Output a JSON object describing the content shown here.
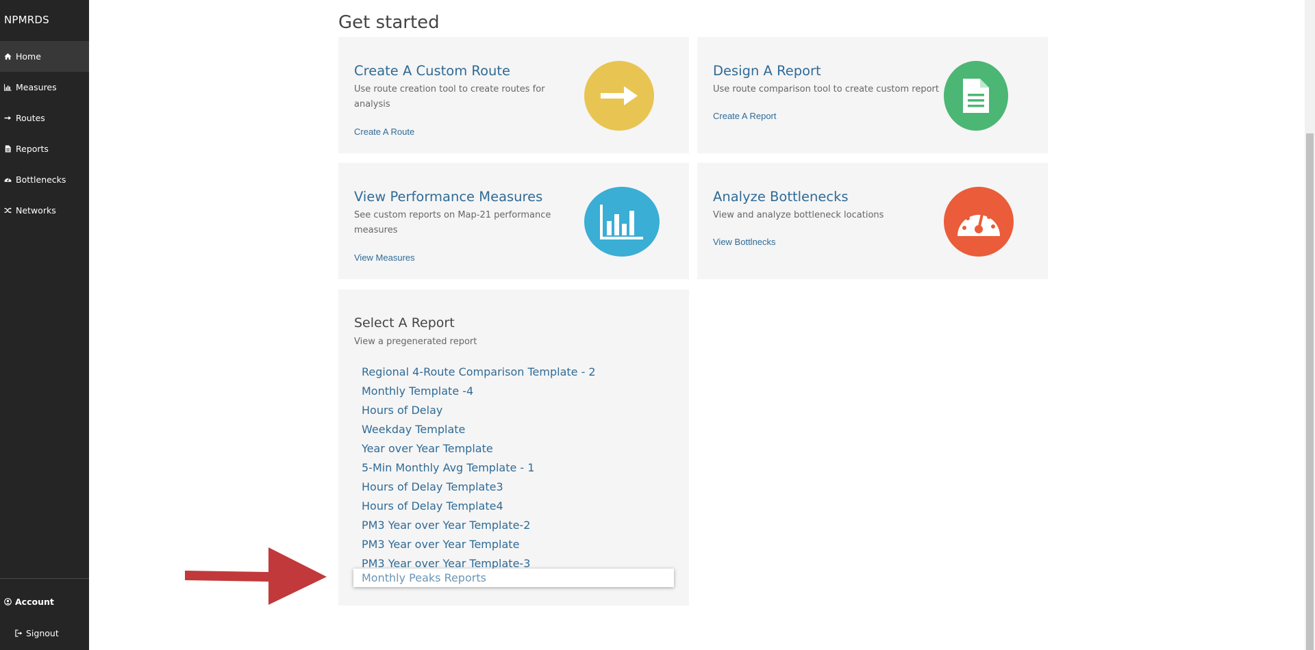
{
  "sidebar": {
    "brand": "NPMRDS",
    "items": [
      {
        "label": "Home",
        "icon": "home-icon"
      },
      {
        "label": "Measures",
        "icon": "bar-chart-icon"
      },
      {
        "label": "Routes",
        "icon": "arrow-right-icon"
      },
      {
        "label": "Reports",
        "icon": "file-icon"
      },
      {
        "label": "Bottlenecks",
        "icon": "dashboard-icon"
      },
      {
        "label": "Networks",
        "icon": "shuffle-icon"
      }
    ],
    "account_label": "Account",
    "signout_label": "Signout"
  },
  "main": {
    "title": "Get started",
    "cards": [
      {
        "title": "Create A Custom Route",
        "description": "Use route creation tool to create routes for analysis",
        "link": "Create A Route",
        "icon": "arrow-right-icon",
        "color": "#e8c552"
      },
      {
        "title": "Design A Report",
        "description": "Use route comparison tool to create custom report",
        "link": "Create A Report",
        "icon": "document-icon",
        "color": "#4cb674"
      },
      {
        "title": "View Performance Measures",
        "description": "See custom reports on Map-21 performance measures",
        "link": "View Measures",
        "icon": "bar-chart-icon",
        "color": "#3aaed4"
      },
      {
        "title": "Analyze Bottlenecks",
        "description": "View and analyze bottleneck locations",
        "link": "View Bottlnecks",
        "icon": "speedometer-icon",
        "color": "#ea5c3a"
      }
    ],
    "report_panel": {
      "title": "Select A Report",
      "subtitle": "View a pregenerated report",
      "reports": [
        "Regional 4-Route Comparison Template - 2",
        "Monthly Template -4",
        "Hours of Delay",
        "Weekday Template",
        "Year over Year Template",
        "5-Min Monthly Avg Template - 1",
        "Hours of Delay Template3",
        "Hours of Delay Template4",
        "PM3 Year over Year Template-2",
        "PM3 Year over Year Template",
        "PM3 Year over Year Template-3"
      ],
      "highlighted_report": "Monthly Peaks Reports"
    }
  },
  "annotation": {
    "arrow_color": "#c1393b"
  }
}
